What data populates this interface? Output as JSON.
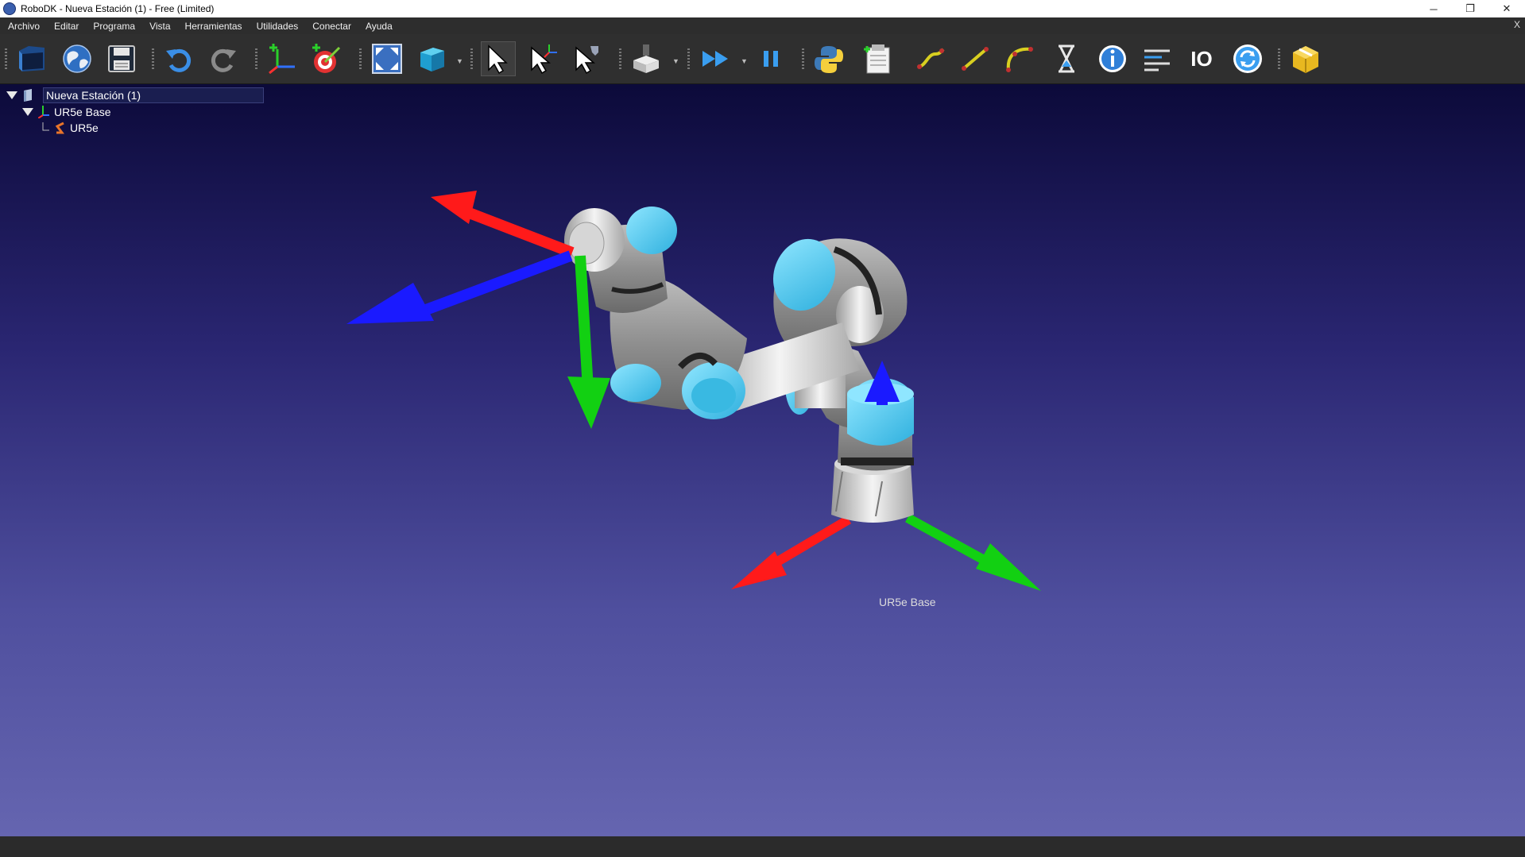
{
  "window": {
    "title": "RoboDK - Nueva Estación (1) - Free (Limited)",
    "minimize": "─",
    "restore": "❐",
    "close": "✕"
  },
  "menu": {
    "items": [
      "Archivo",
      "Editar",
      "Programa",
      "Vista",
      "Herramientas",
      "Utilidades",
      "Conectar",
      "Ayuda"
    ],
    "close": "X"
  },
  "toolbar": {
    "io_label": "IO",
    "icons": [
      "open-icon",
      "library-globe-icon",
      "save-icon",
      "undo-icon",
      "redo-icon",
      "add-reference-frame-icon",
      "add-target-icon",
      "fit-all-icon",
      "view-cube-icon",
      "select-icon",
      "move-reference-icon",
      "move-tool-icon",
      "tool-holder-icon",
      "run-program-icon",
      "pause-icon",
      "python-icon",
      "program-instruction-icon",
      "joint-move-icon",
      "linear-move-icon",
      "circular-move-icon",
      "pause-instruction-icon",
      "program-call-icon",
      "set-speed-icon",
      "io-icon",
      "refresh-icon",
      "package-icon"
    ]
  },
  "tree": {
    "station": "Nueva Estación (1)",
    "base": "UR5e Base",
    "robot": "UR5e"
  },
  "viewport": {
    "base_label": "UR5e Base"
  },
  "colors": {
    "axis_x": "#ff0000",
    "axis_y": "#00cc00",
    "axis_z": "#0000ff",
    "robot_cap": "#4fc3e8",
    "robot_body": "#9a9a9a"
  }
}
